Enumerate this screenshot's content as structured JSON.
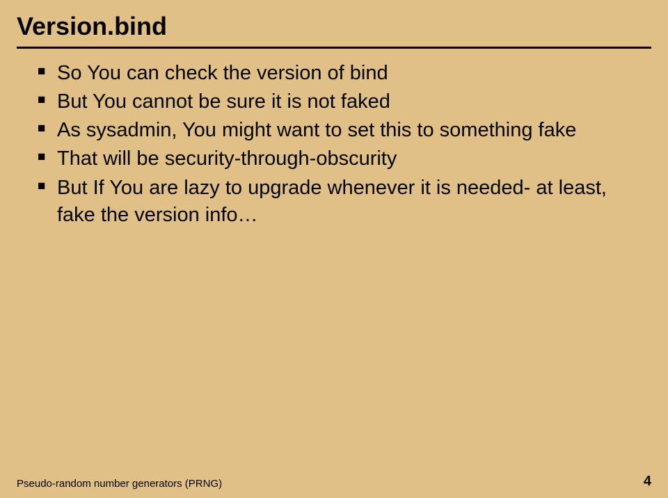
{
  "slide": {
    "title": "Version.bind",
    "bullets": [
      "So You can check the version of bind",
      "But You cannot be sure it is not faked",
      "As sysadmin, You might want to set this to something fake",
      "That will be security-through-obscurity",
      "But If You are lazy to upgrade whenever it is needed- at least, fake the version info…"
    ],
    "footer": {
      "text": "Pseudo-random number generators (PRNG)",
      "page": "4"
    }
  }
}
